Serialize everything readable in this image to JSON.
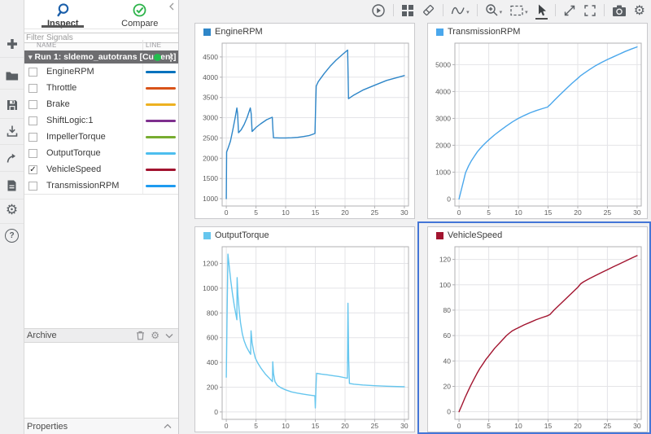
{
  "left_rail": {
    "icons": [
      "add",
      "open",
      "save",
      "import",
      "export",
      "create-report",
      "preferences",
      "help"
    ]
  },
  "sidebar": {
    "tabs": [
      {
        "label": "Inspect",
        "active": true
      },
      {
        "label": "Compare",
        "active": false
      }
    ],
    "filter_placeholder": "Filter Signals",
    "columns": {
      "name": "NAME",
      "line": "LINE"
    },
    "run": {
      "label": "Run 1: sldemo_autotrans [Current]",
      "status_dot_color": "#23be4e"
    },
    "signals": [
      {
        "name": "EngineRPM",
        "color": "#0072BD",
        "checked": false
      },
      {
        "name": "Throttle",
        "color": "#D95319",
        "checked": false
      },
      {
        "name": "Brake",
        "color": "#EDB120",
        "checked": false
      },
      {
        "name": "ShiftLogic:1",
        "color": "#7E2F8E",
        "checked": false
      },
      {
        "name": "ImpellerTorque",
        "color": "#77AC30",
        "checked": false
      },
      {
        "name": "OutputTorque",
        "color": "#4DBEEE",
        "checked": false
      },
      {
        "name": "VehicleSpeed",
        "color": "#A2142F",
        "checked": true
      },
      {
        "name": "TransmissionRPM",
        "color": "#1E9BF0",
        "checked": false
      }
    ],
    "archive_label": "Archive",
    "properties_label": "Properties"
  },
  "plot_toolbar": {
    "icons": [
      "playback-controls",
      "subplot-layout",
      "clear-subplots",
      "signal-options",
      "zoom-in",
      "fit-to-view",
      "pointer",
      "expand",
      "fullscreen",
      "snapshot",
      "settings"
    ],
    "active_tool": "pointer"
  },
  "selection": {
    "selected_subplot": "VehicleSpeed",
    "ring_color": "#4476d7"
  },
  "chart_data": [
    {
      "type": "line",
      "title": "EngineRPM",
      "color": "#2E86C8",
      "legend_pos": "top-left",
      "xlabel": "",
      "ylabel": "",
      "grid": true,
      "selected": false,
      "xlim": [
        -0.7,
        30.7
      ],
      "ylim": [
        820,
        4840
      ],
      "xticks": [
        0,
        5,
        10,
        15,
        20,
        25,
        30
      ],
      "yticks": [
        1000,
        1500,
        2000,
        2500,
        3000,
        3500,
        4000,
        4500
      ],
      "points": [
        [
          0,
          1000
        ],
        [
          0.06,
          2150
        ],
        [
          0.3,
          2250
        ],
        [
          0.7,
          2420
        ],
        [
          1.1,
          2700
        ],
        [
          1.5,
          3000
        ],
        [
          1.78,
          3240
        ],
        [
          1.9,
          3100
        ],
        [
          2.05,
          2630
        ],
        [
          2.5,
          2700
        ],
        [
          3.0,
          2830
        ],
        [
          3.5,
          3000
        ],
        [
          4.05,
          3240
        ],
        [
          4.2,
          3100
        ],
        [
          4.35,
          2660
        ],
        [
          5.0,
          2760
        ],
        [
          5.8,
          2850
        ],
        [
          6.8,
          2950
        ],
        [
          7.75,
          3010
        ],
        [
          7.85,
          2700
        ],
        [
          7.95,
          2505
        ],
        [
          9,
          2500
        ],
        [
          10,
          2500
        ],
        [
          11,
          2505
        ],
        [
          12,
          2515
        ],
        [
          13,
          2535
        ],
        [
          14,
          2560
        ],
        [
          14.95,
          2610
        ],
        [
          15.05,
          3300
        ],
        [
          15.15,
          3780
        ],
        [
          15.5,
          3890
        ],
        [
          16.5,
          4090
        ],
        [
          17.5,
          4270
        ],
        [
          18.5,
          4420
        ],
        [
          19.5,
          4550
        ],
        [
          20.45,
          4670
        ],
        [
          20.6,
          3470
        ],
        [
          21.5,
          3560
        ],
        [
          23,
          3680
        ],
        [
          25,
          3800
        ],
        [
          27,
          3920
        ],
        [
          29,
          4000
        ],
        [
          30,
          4040
        ]
      ]
    },
    {
      "type": "line",
      "title": "TransmissionRPM",
      "color": "#4AA7EC",
      "legend_pos": "top-left",
      "xlabel": "",
      "ylabel": "",
      "grid": true,
      "selected": false,
      "xlim": [
        -0.7,
        30.7
      ],
      "ylim": [
        -260,
        5800
      ],
      "xticks": [
        0,
        5,
        10,
        15,
        20,
        25,
        30
      ],
      "yticks": [
        0,
        1000,
        2000,
        3000,
        4000,
        5000
      ],
      "points": [
        [
          0,
          0
        ],
        [
          0.3,
          270
        ],
        [
          0.7,
          620
        ],
        [
          1.1,
          980
        ],
        [
          1.6,
          1230
        ],
        [
          2.1,
          1430
        ],
        [
          2.6,
          1600
        ],
        [
          3.1,
          1760
        ],
        [
          3.6,
          1890
        ],
        [
          4.1,
          2010
        ],
        [
          4.6,
          2120
        ],
        [
          5.1,
          2220
        ],
        [
          6,
          2390
        ],
        [
          7,
          2560
        ],
        [
          8,
          2720
        ],
        [
          9,
          2870
        ],
        [
          10,
          3000
        ],
        [
          11,
          3110
        ],
        [
          12,
          3210
        ],
        [
          13,
          3290
        ],
        [
          14,
          3360
        ],
        [
          14.9,
          3420
        ],
        [
          15.4,
          3520
        ],
        [
          16,
          3660
        ],
        [
          17,
          3880
        ],
        [
          18,
          4090
        ],
        [
          19,
          4300
        ],
        [
          20,
          4490
        ],
        [
          20.5,
          4590
        ],
        [
          21,
          4670
        ],
        [
          22,
          4820
        ],
        [
          23,
          4960
        ],
        [
          24,
          5080
        ],
        [
          25,
          5190
        ],
        [
          26,
          5290
        ],
        [
          27,
          5390
        ],
        [
          28,
          5490
        ],
        [
          29,
          5580
        ],
        [
          30,
          5660
        ]
      ]
    },
    {
      "type": "line",
      "title": "OutputTorque",
      "color": "#66C6EE",
      "legend_pos": "top-left",
      "xlabel": "",
      "ylabel": "",
      "grid": true,
      "selected": false,
      "xlim": [
        -0.7,
        30.7
      ],
      "ylim": [
        -60,
        1335
      ],
      "xticks": [
        0,
        5,
        10,
        15,
        20,
        25,
        30
      ],
      "yticks": [
        0,
        200,
        400,
        600,
        800,
        1000,
        1200
      ],
      "points": [
        [
          0,
          280
        ],
        [
          0.12,
          760
        ],
        [
          0.28,
          1275
        ],
        [
          0.5,
          1170
        ],
        [
          0.75,
          1060
        ],
        [
          1.05,
          950
        ],
        [
          1.35,
          855
        ],
        [
          1.65,
          780
        ],
        [
          1.78,
          745
        ],
        [
          1.82,
          1085
        ],
        [
          1.95,
          950
        ],
        [
          2.15,
          830
        ],
        [
          2.4,
          720
        ],
        [
          2.7,
          630
        ],
        [
          3.0,
          575
        ],
        [
          3.4,
          525
        ],
        [
          3.8,
          490
        ],
        [
          4.1,
          465
        ],
        [
          4.17,
          655
        ],
        [
          4.35,
          560
        ],
        [
          4.6,
          490
        ],
        [
          4.9,
          435
        ],
        [
          5.3,
          395
        ],
        [
          5.9,
          350
        ],
        [
          6.6,
          305
        ],
        [
          7.3,
          270
        ],
        [
          7.77,
          245
        ],
        [
          7.83,
          405
        ],
        [
          7.95,
          310
        ],
        [
          8.2,
          245
        ],
        [
          8.6,
          215
        ],
        [
          9.2,
          195
        ],
        [
          10,
          178
        ],
        [
          11,
          162
        ],
        [
          12,
          152
        ],
        [
          13,
          143
        ],
        [
          14,
          136
        ],
        [
          14.93,
          130
        ],
        [
          15.0,
          32
        ],
        [
          15.1,
          180
        ],
        [
          15.2,
          312
        ],
        [
          16,
          306
        ],
        [
          17,
          300
        ],
        [
          18,
          293
        ],
        [
          19,
          286
        ],
        [
          20.4,
          272
        ],
        [
          20.5,
          878
        ],
        [
          20.62,
          420
        ],
        [
          20.75,
          230
        ],
        [
          21.5,
          224
        ],
        [
          23,
          218
        ],
        [
          25,
          212
        ],
        [
          27,
          208
        ],
        [
          30,
          203
        ]
      ]
    },
    {
      "type": "line",
      "title": "VehicleSpeed",
      "color": "#A2142F",
      "legend_pos": "top-left",
      "xlabel": "",
      "ylabel": "",
      "grid": true,
      "selected": true,
      "xlim": [
        -0.7,
        30.7
      ],
      "ylim": [
        -6,
        130
      ],
      "xticks": [
        0,
        5,
        10,
        15,
        20,
        25,
        30
      ],
      "yticks": [
        0,
        20,
        40,
        60,
        80,
        100,
        120
      ],
      "points": [
        [
          0,
          0
        ],
        [
          0.5,
          5.5
        ],
        [
          1,
          11
        ],
        [
          1.5,
          16
        ],
        [
          2,
          21
        ],
        [
          2.5,
          25.5
        ],
        [
          3,
          30
        ],
        [
          3.5,
          34
        ],
        [
          4,
          37.5
        ],
        [
          4.5,
          41
        ],
        [
          5,
          44
        ],
        [
          5.5,
          47
        ],
        [
          6,
          50
        ],
        [
          6.5,
          52.5
        ],
        [
          7,
          55
        ],
        [
          7.5,
          57.5
        ],
        [
          8,
          60
        ],
        [
          8.5,
          62
        ],
        [
          9,
          63.8
        ],
        [
          9.5,
          65
        ],
        [
          10,
          66.2
        ],
        [
          11,
          68.5
        ],
        [
          12,
          70.5
        ],
        [
          13,
          72.5
        ],
        [
          14,
          74.2
        ],
        [
          14.9,
          75.6
        ],
        [
          15.3,
          76.5
        ],
        [
          16,
          80
        ],
        [
          17,
          84.5
        ],
        [
          18,
          89
        ],
        [
          19,
          93.5
        ],
        [
          20,
          98
        ],
        [
          20.5,
          100.8
        ],
        [
          21,
          102.4
        ],
        [
          22,
          105
        ],
        [
          23,
          107.3
        ],
        [
          24,
          109.6
        ],
        [
          25,
          111.9
        ],
        [
          26,
          114.2
        ],
        [
          27,
          116.4
        ],
        [
          28,
          118.6
        ],
        [
          29,
          120.8
        ],
        [
          30,
          123
        ]
      ]
    }
  ]
}
